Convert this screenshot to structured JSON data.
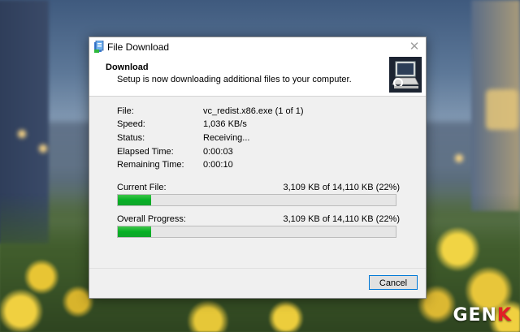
{
  "window": {
    "title": "File Download"
  },
  "header": {
    "title": "Download",
    "subtitle": "Setup is now downloading additional files to your computer."
  },
  "details": [
    {
      "label": "File:",
      "value": "vc_redist.x86.exe (1 of 1)"
    },
    {
      "label": "Speed:",
      "value": "1,036 KB/s"
    },
    {
      "label": "Status:",
      "value": "Receiving..."
    },
    {
      "label": "Elapsed Time:",
      "value": "0:00:03"
    },
    {
      "label": "Remaining Time:",
      "value": "0:00:10"
    }
  ],
  "current_file": {
    "label": "Current File:",
    "value": "3,109 KB of 14,110 KB (22%)",
    "progress": 0.12
  },
  "overall": {
    "label": "Overall Progress:",
    "value": "3,109 KB of 14,110 KB (22%)",
    "progress": 0.12
  },
  "buttons": {
    "cancel": "Cancel"
  },
  "watermark": {
    "text_main": "GEN",
    "text_accent": "K"
  },
  "colors": {
    "progress_fill": "#06b025",
    "button_focus_border": "#0078d7",
    "watermark_accent": "#e21f26"
  }
}
